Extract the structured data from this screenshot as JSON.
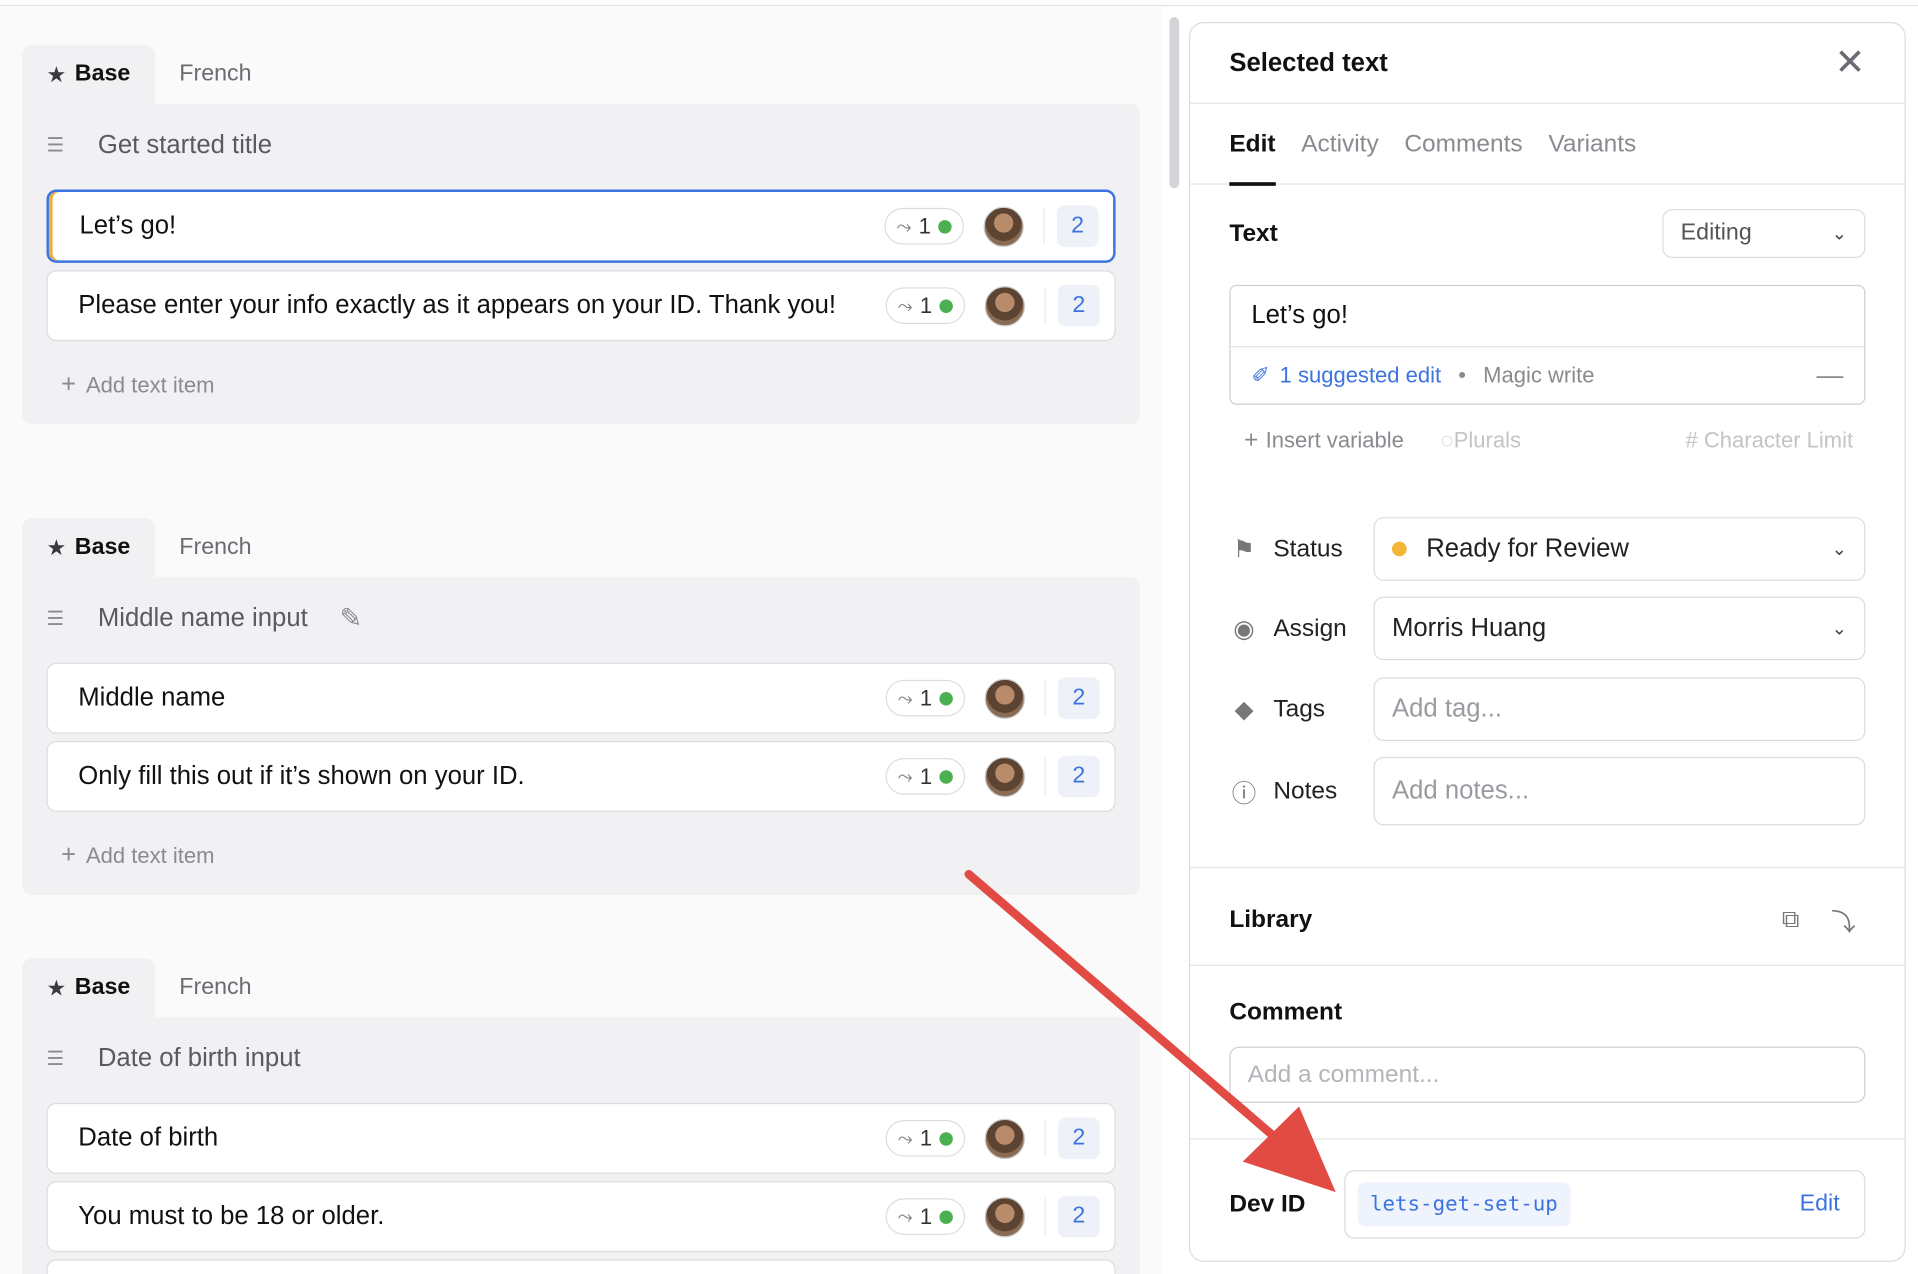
{
  "groups": [
    {
      "tabs": [
        "Base",
        "French"
      ],
      "title": "Get started title",
      "items": [
        {
          "text": "Let’s go!",
          "branches": "1",
          "count": "2",
          "selected": true
        },
        {
          "text": "Please enter your info exactly as it appears on your ID. Thank you!",
          "branches": "1",
          "count": "2"
        }
      ],
      "add_label": "Add text item"
    },
    {
      "tabs": [
        "Base",
        "French"
      ],
      "title": "Middle name input",
      "items": [
        {
          "text": "Middle name",
          "branches": "1",
          "count": "2"
        },
        {
          "text": "Only fill this out if it’s shown on your ID.",
          "branches": "1",
          "count": "2"
        }
      ],
      "add_label": "Add text item"
    },
    {
      "tabs": [
        "Base",
        "French"
      ],
      "title": "Date of birth input",
      "items": [
        {
          "text": "Date of birth",
          "branches": "1",
          "count": "2"
        },
        {
          "text": "You must to be 18 or older.",
          "branches": "1",
          "count": "2"
        }
      ]
    }
  ],
  "panel": {
    "title": "Selected text",
    "tabs": [
      "Edit",
      "Activity",
      "Comments",
      "Variants"
    ],
    "text_label": "Text",
    "mode": "Editing",
    "text_value": "Let’s go!",
    "suggested": "1 suggested edit",
    "magic": "Magic write",
    "insert_variable": "Insert variable",
    "plurals": "Plurals",
    "char_limit": "# Character Limit",
    "status_label": "Status",
    "status_value": "Ready for Review",
    "status_color": "#f4b536",
    "assign_label": "Assign",
    "assign_value": "Morris Huang",
    "tags_label": "Tags",
    "tags_placeholder": "Add tag...",
    "notes_label": "Notes",
    "notes_placeholder": "Add notes...",
    "library_label": "Library",
    "comment_label": "Comment",
    "comment_placeholder": "Add a comment...",
    "devid_label": "Dev ID",
    "devid_value": "lets-get-set-up",
    "devid_edit": "Edit"
  },
  "colors": {
    "accent": "#3b74e0",
    "annotation_arrow": "#e24a44",
    "branch_dot": "#4caf50"
  }
}
